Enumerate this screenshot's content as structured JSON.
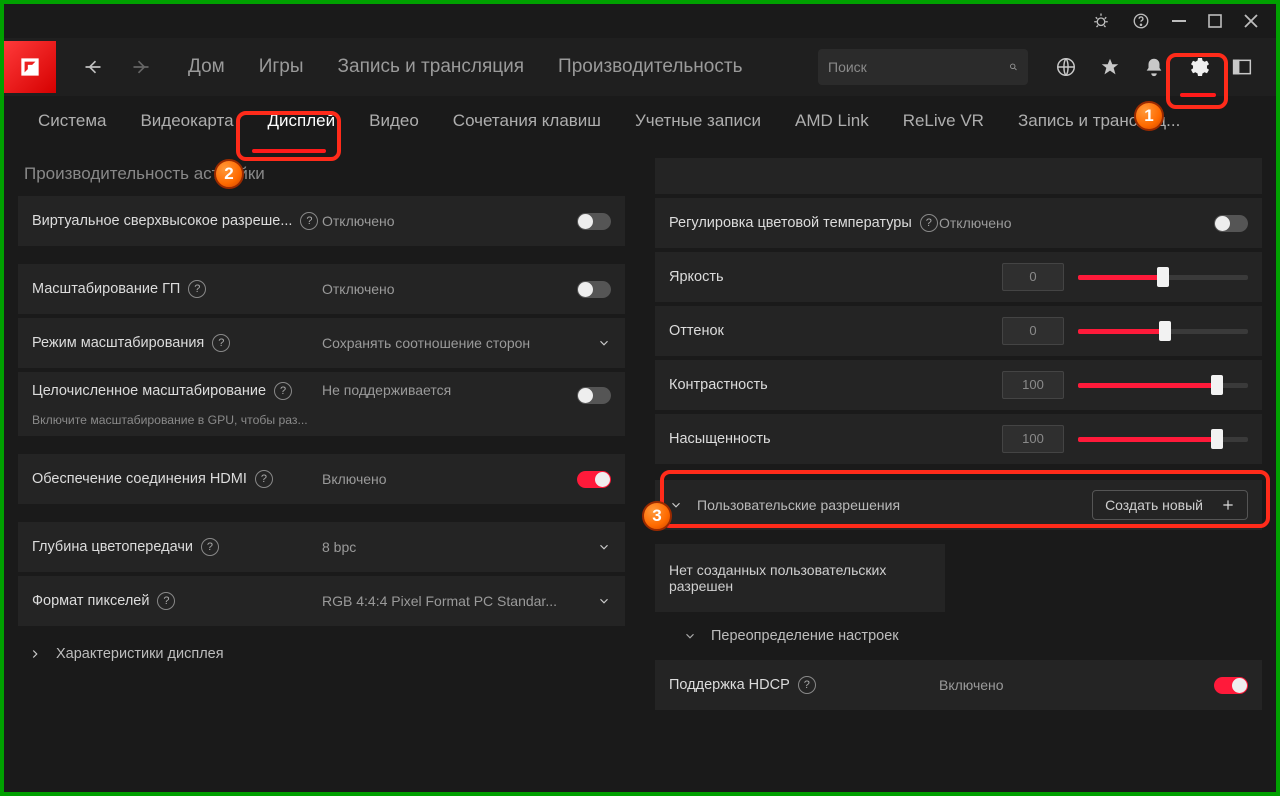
{
  "win": {
    "bug": "bug",
    "help": "?",
    "min": "—",
    "max": "□",
    "close": "✕"
  },
  "nav": {
    "items": [
      "Дом",
      "Игры",
      "Запись и трансляция",
      "Производительность"
    ]
  },
  "search": {
    "placeholder": "Поиск"
  },
  "subtabs": [
    "Система",
    "Видеокарта",
    "Дисплей",
    "Видео",
    "Сочетания клавиш",
    "Учетные записи",
    "AMD Link",
    "ReLive VR",
    "Запись и трансляц..."
  ],
  "left": {
    "section": "Производительность        астройки",
    "vsr": {
      "label": "Виртуальное сверхвысокое разреше...",
      "value": "Отключено"
    },
    "gpuscale": {
      "label": "Масштабирование ГП",
      "value": "Отключено"
    },
    "mode": {
      "label": "Режим масштабирования",
      "value": "Сохранять соотношение сторон"
    },
    "intscale": {
      "label": "Целочисленное масштабирование",
      "value": "Не поддерживается",
      "sub": "Включите масштабирование в GPU, чтобы раз..."
    },
    "hdmi": {
      "label": "Обеспечение соединения HDMI",
      "value": "Включено"
    },
    "depth": {
      "label": "Глубина цветопередачи",
      "value": "8 bpc"
    },
    "pixfmt": {
      "label": "Формат пикселей",
      "value": "RGB 4:4:4 Pixel Format PC Standar..."
    },
    "specs": "Характеристики дисплея"
  },
  "right": {
    "temp": {
      "label": "Регулировка цветовой температуры",
      "value": "Отключено"
    },
    "bright": {
      "label": "Яркость",
      "num": "0",
      "pct": 50
    },
    "hue": {
      "label": "Оттенок",
      "num": "0",
      "pct": 51
    },
    "contrast": {
      "label": "Контрастность",
      "num": "100",
      "pct": 82
    },
    "sat": {
      "label": "Насыщенность",
      "num": "100",
      "pct": 82
    },
    "custom": {
      "label": "Пользовательские разрешения",
      "btn": "Создать новый"
    },
    "none": "Нет созданных пользовательских разрешен",
    "override": "Переопределение настроек",
    "hdcp": {
      "label": "Поддержка HDCP",
      "value": "Включено"
    }
  }
}
